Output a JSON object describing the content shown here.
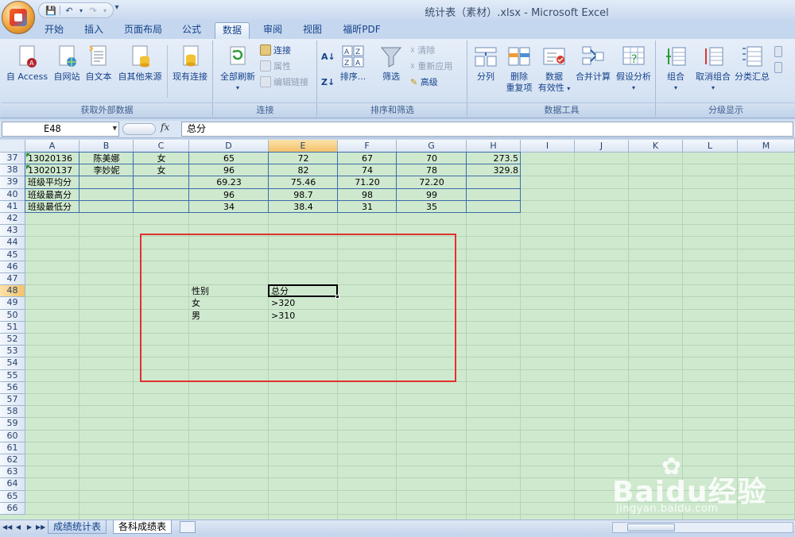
{
  "window": {
    "title": "统计表（素材）.xlsx - Microsoft Excel"
  },
  "ribbon_tabs": [
    "开始",
    "插入",
    "页面布局",
    "公式",
    "数据",
    "审阅",
    "视图",
    "福昕PDF"
  ],
  "active_tab": "数据",
  "ribbon": {
    "get_external": {
      "label": "获取外部数据",
      "buttons": [
        "自 Access",
        "自网站",
        "自文本",
        "自其他来源",
        "现有连接"
      ]
    },
    "connections": {
      "label": "连接",
      "refresh_all": "全部刷新",
      "small": [
        "连接",
        "属性",
        "编辑链接"
      ]
    },
    "sort_filter": {
      "label": "排序和筛选",
      "sort": "排序...",
      "filter": "筛选",
      "small": [
        "清除",
        "重新应用",
        "高级"
      ]
    },
    "data_tools": {
      "label": "数据工具",
      "split": "分列",
      "remove_dup_1": "删除",
      "remove_dup_2": "重复项",
      "validation_1": "数据",
      "validation_2": "有效性",
      "consolidate": "合并计算",
      "whatif": "假设分析"
    },
    "outline": {
      "label": "分级显示",
      "group": "组合",
      "ungroup": "取消组合",
      "subtotal": "分类汇总"
    }
  },
  "formula_bar": {
    "name_box": "E48",
    "fx": "fx",
    "formula": "总分"
  },
  "columns": [
    "A",
    "B",
    "C",
    "D",
    "E",
    "F",
    "G",
    "H",
    "I",
    "J",
    "K",
    "L",
    "M"
  ],
  "selected_column": "E",
  "rows": [
    37,
    38,
    39,
    40,
    41,
    42,
    43,
    44,
    45,
    46,
    47,
    48,
    49,
    50,
    51,
    52,
    53,
    54,
    55,
    56,
    57,
    58,
    59,
    60,
    61,
    62,
    63,
    64,
    65,
    66
  ],
  "selected_row": 48,
  "table_rows": [
    {
      "A": "13020136",
      "B": "陈美娜",
      "C": "女",
      "D": "65",
      "E": "72",
      "F": "67",
      "G": "70",
      "H": "273.5"
    },
    {
      "A": "13020137",
      "B": "李妙妮",
      "C": "女",
      "D": "96",
      "E": "82",
      "F": "74",
      "G": "78",
      "H": "329.8"
    },
    {
      "A": "班级平均分",
      "B": "",
      "C": "",
      "D": "69.23",
      "E": "75.46",
      "F": "71.20",
      "G": "72.20",
      "H": ""
    },
    {
      "A": "班级最高分",
      "B": "",
      "C": "",
      "D": "96",
      "E": "98.7",
      "F": "98",
      "G": "99",
      "H": ""
    },
    {
      "A": "班级最低分",
      "B": "",
      "C": "",
      "D": "34",
      "E": "38.4",
      "F": "31",
      "G": "35",
      "H": ""
    }
  ],
  "criteria": {
    "d48": "性别",
    "e48": "总分",
    "d49": "女",
    "e49": ">320",
    "d50": "男",
    "e50": ">310"
  },
  "sheet_tabs": [
    "成绩统计表",
    "各科成绩表"
  ],
  "active_sheet": "各科成绩表",
  "watermark": {
    "brand": "Baidu经验",
    "url": "jingyan.baidu.com"
  },
  "colors": {
    "sheet_background": "#cfe9cf",
    "highlight_box": "#e0322f",
    "selection_header": "#f3c26b"
  }
}
